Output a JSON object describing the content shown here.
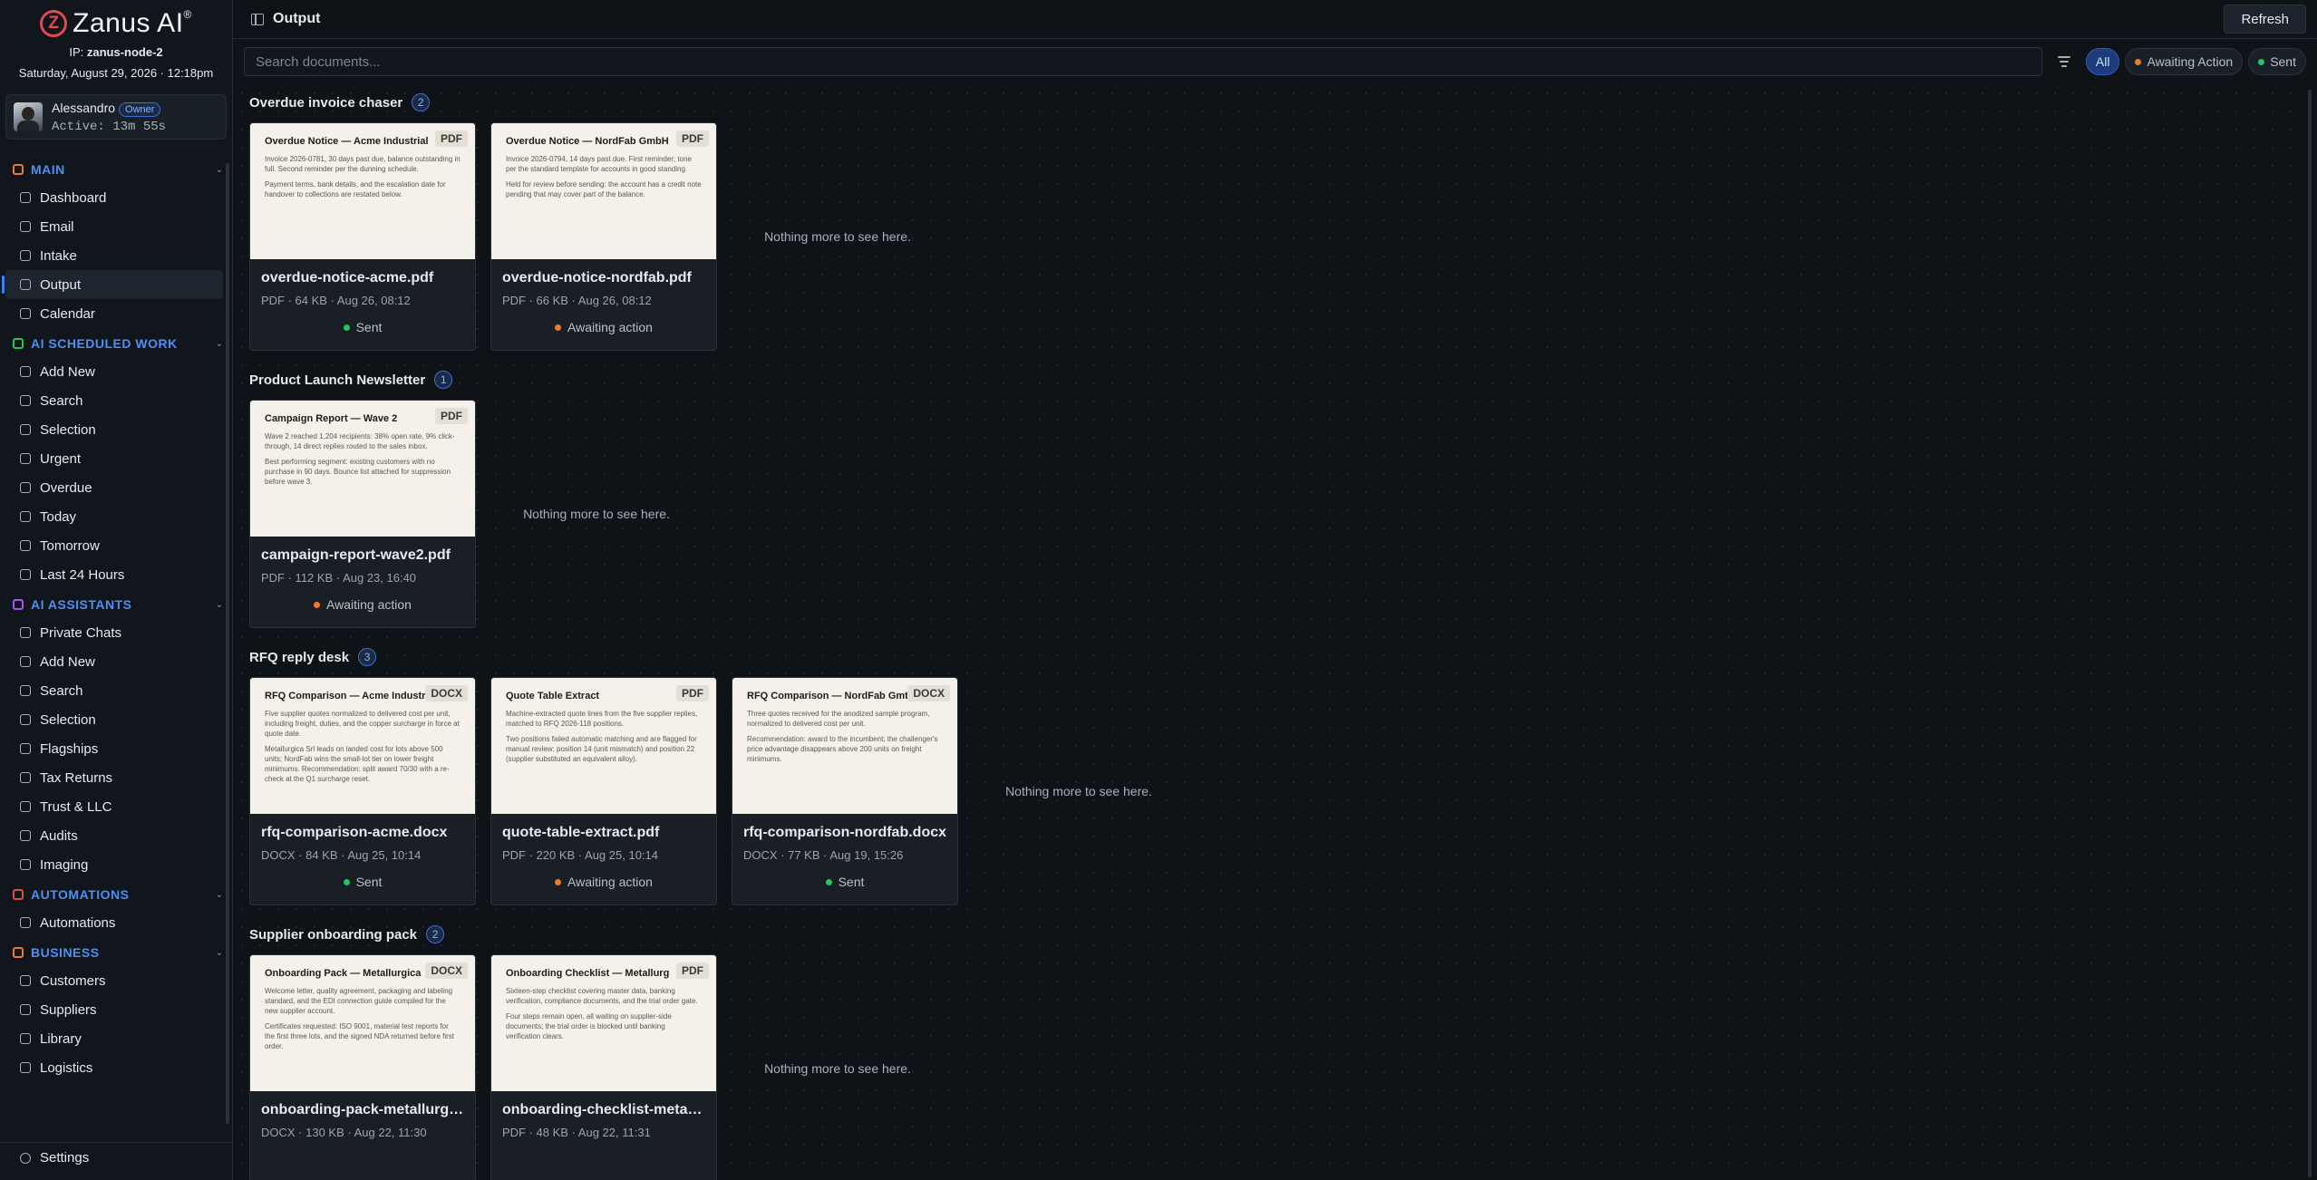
{
  "brand": {
    "logo_letter": "Z",
    "name": "Zanus AI",
    "registered": "®"
  },
  "node": {
    "label": "IP:",
    "value": "zanus-node-2"
  },
  "datetime": "Saturday, August 29, 2026 · 12:18pm",
  "user": {
    "name": "Alessandro",
    "role": "Owner",
    "active": "Active: 13m 55s"
  },
  "sidebar": {
    "sections": [
      {
        "label": "MAIN",
        "color": "#f07a2c",
        "items": [
          "Dashboard",
          "Email",
          "Intake",
          "Output",
          "Calendar"
        ]
      },
      {
        "label": "AI SCHEDULED WORK",
        "color": "#22c55e",
        "items": [
          "Add New",
          "Search",
          "Selection",
          "Urgent",
          "Overdue",
          "Today",
          "Tomorrow",
          "Last 24 Hours"
        ]
      },
      {
        "label": "AI ASSISTANTS",
        "color": "#a855f7",
        "items": [
          "Private Chats",
          "Add New",
          "Search",
          "Selection",
          "Flagships",
          "Tax Returns",
          "Trust & LLC",
          "Audits",
          "Imaging"
        ]
      },
      {
        "label": "AUTOMATIONS",
        "color": "#e5484d",
        "items": [
          "Automations"
        ]
      },
      {
        "label": "BUSINESS",
        "color": "#f07a2c",
        "items": [
          "Customers",
          "Suppliers",
          "Library",
          "Logistics"
        ]
      }
    ],
    "active_item": "Output",
    "settings_label": "Settings"
  },
  "header": {
    "title": "Output",
    "refresh_label": "Refresh"
  },
  "filters": {
    "search_placeholder": "Search documents...",
    "chips": [
      {
        "label": "All",
        "active": true,
        "dot": ""
      },
      {
        "label": "Awaiting Action",
        "active": false,
        "dot": "#f07a2c"
      },
      {
        "label": "Sent",
        "active": false,
        "dot": "#22c55e"
      }
    ]
  },
  "status_colors": {
    "Sent": "#22c55e",
    "Awaiting action": "#f07a2c"
  },
  "empty_text": "Nothing more to see here.",
  "groups": [
    {
      "title": "Overdue invoice chaser",
      "count": "2",
      "cards": [
        {
          "preview_title": "Overdue Notice — Acme Industrial",
          "type": "PDF",
          "paras": [
            "Invoice 2026-0781, 30 days past due, balance outstanding in full. Second reminder per the dunning schedule.",
            "Payment terms, bank details, and the escalation date for handover to collections are restated below."
          ],
          "filename": "overdue-notice-acme.pdf",
          "meta": "PDF · 64 KB · Aug 26, 08:12",
          "status": "Sent"
        },
        {
          "preview_title": "Overdue Notice — NordFab GmbH",
          "type": "PDF",
          "paras": [
            "Invoice 2026-0794, 14 days past due. First reminder; tone per the standard template for accounts in good standing.",
            "Held for review before sending: the account has a credit note pending that may cover part of the balance."
          ],
          "filename": "overdue-notice-nordfab.pdf",
          "meta": "PDF · 66 KB · Aug 26, 08:12",
          "status": "Awaiting action"
        }
      ]
    },
    {
      "title": "Product Launch Newsletter",
      "count": "1",
      "cards": [
        {
          "preview_title": "Campaign Report — Wave 2",
          "type": "PDF",
          "paras": [
            "Wave 2 reached 1,204 recipients: 38% open rate, 9% click-through, 14 direct replies routed to the sales inbox.",
            "Best performing segment: existing customers with no purchase in 90 days. Bounce list attached for suppression before wave 3."
          ],
          "filename": "campaign-report-wave2.pdf",
          "meta": "PDF · 112 KB · Aug 23, 16:40",
          "status": "Awaiting action"
        }
      ]
    },
    {
      "title": "RFQ reply desk",
      "count": "3",
      "cards": [
        {
          "preview_title": "RFQ Comparison — Acme Industr",
          "type": "DOCX",
          "paras": [
            "Five supplier quotes normalized to delivered cost per unit, including freight, duties, and the copper surcharge in force at quote date.",
            "Metallurgica Srl leads on landed cost for lots above 500 units; NordFab wins the small-lot tier on lower freight minimums. Recommendation: split award 70/30 with a re-check at the Q1 surcharge reset."
          ],
          "filename": "rfq-comparison-acme.docx",
          "meta": "DOCX · 84 KB · Aug 25, 10:14",
          "status": "Sent"
        },
        {
          "preview_title": "Quote Table Extract",
          "type": "PDF",
          "paras": [
            "Machine-extracted quote lines from the five supplier replies, matched to RFQ 2026-118 positions.",
            "Two positions failed automatic matching and are flagged for manual review: position 14 (unit mismatch) and position 22 (supplier substituted an equivalent alloy)."
          ],
          "filename": "quote-table-extract.pdf",
          "meta": "PDF · 220 KB · Aug 25, 10:14",
          "status": "Awaiting action"
        },
        {
          "preview_title": "RFQ Comparison — NordFab Gmt",
          "type": "DOCX",
          "paras": [
            "Three quotes received for the anodized sample program, normalized to delivered cost per unit.",
            "Recommendation: award to the incumbent; the challenger's price advantage disappears above 200 units on freight minimums."
          ],
          "filename": "rfq-comparison-nordfab.docx",
          "meta": "DOCX · 77 KB · Aug 19, 15:26",
          "status": "Sent"
        }
      ]
    },
    {
      "title": "Supplier onboarding pack",
      "count": "2",
      "cards": [
        {
          "preview_title": "Onboarding Pack — Metallurgica",
          "type": "DOCX",
          "paras": [
            "Welcome letter, quality agreement, packaging and labeling standard, and the EDI connection guide compiled for the new supplier account.",
            "Certificates requested: ISO 9001, material test reports for the first three lots, and the signed NDA returned before first order."
          ],
          "filename": "onboarding-pack-metallurgi...",
          "meta": "DOCX · 130 KB · Aug 22, 11:30",
          "status": ""
        },
        {
          "preview_title": "Onboarding Checklist — Metallurg",
          "type": "PDF",
          "paras": [
            "Sixteen-step checklist covering master data, banking verification, compliance documents, and the trial order gate.",
            "Four steps remain open, all waiting on supplier-side documents; the trial order is blocked until banking verification clears."
          ],
          "filename": "onboarding-checklist-metall...",
          "meta": "PDF · 48 KB · Aug 22, 11:31",
          "status": ""
        }
      ]
    }
  ]
}
